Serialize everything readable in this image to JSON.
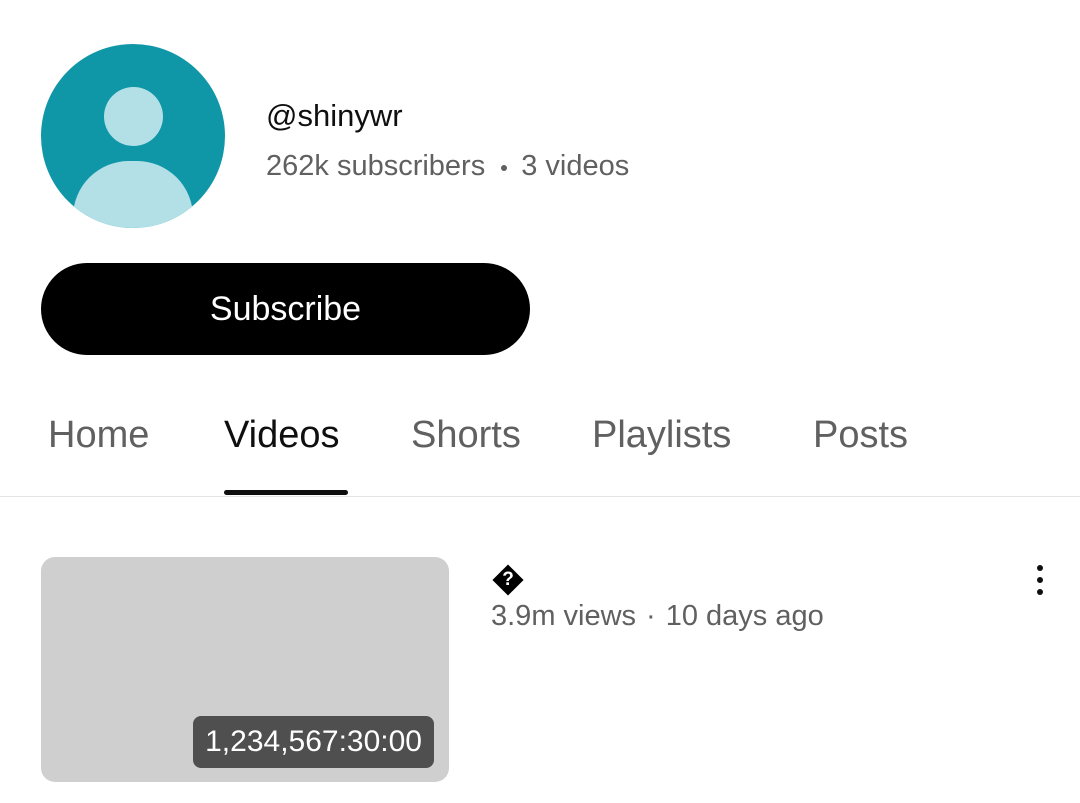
{
  "channel": {
    "handle": "@shinywr",
    "subscribers": "262k subscribers",
    "video_count": "3 videos",
    "avatar_icon": "default-avatar-icon",
    "avatar_color": "#0f97a8"
  },
  "subscribe_label": "Subscribe",
  "tabs": [
    {
      "label": "Home",
      "active": false
    },
    {
      "label": "Videos",
      "active": true
    },
    {
      "label": "Shorts",
      "active": false
    },
    {
      "label": "Playlists",
      "active": false
    },
    {
      "label": "Posts",
      "active": false
    }
  ],
  "videos": [
    {
      "title": "�",
      "views": "3.9m views",
      "separator": "·",
      "age": "10 days ago",
      "duration": "1,234,567:30:00",
      "menu_icon": "more-vert-icon"
    }
  ]
}
